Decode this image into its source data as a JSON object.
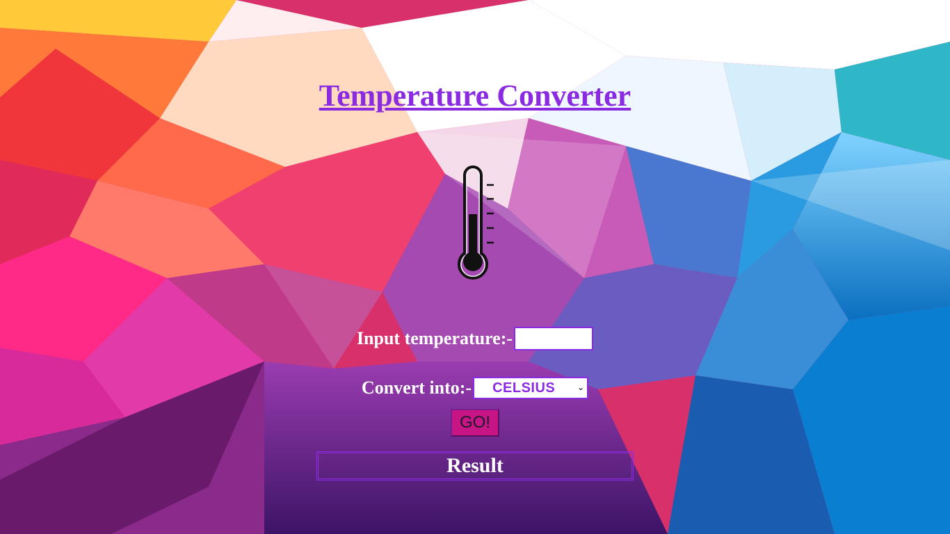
{
  "page": {
    "title": "Temperature Converter"
  },
  "form": {
    "input_label": "Input temperature:-",
    "input_value": "",
    "convert_label": "Convert into:-",
    "unit_selected": "CELSIUS",
    "go_label": "GO!",
    "result_label": "Result"
  },
  "icons": {
    "thermometer": "thermometer-icon",
    "select_arrow": "chevron-down-icon"
  },
  "colors": {
    "accent": "#8a2be2",
    "button": "#c71585",
    "label_text": "#ffffff"
  }
}
